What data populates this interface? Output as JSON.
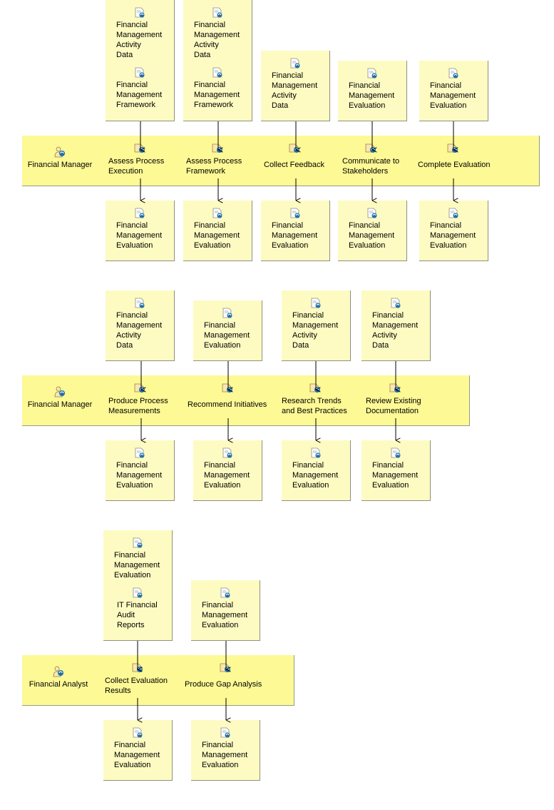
{
  "diagram": {
    "sections": [
      {
        "role": "Financial Manager",
        "tasks": [
          {
            "name": "Assess Process\nExecution",
            "inputs": [
              "Financial\nManagement\nActivity\nData",
              "Financial\nManagement\nFramework"
            ],
            "outputs": [
              "Financial\nManagement\nEvaluation"
            ]
          },
          {
            "name": "Assess Process\nFramework",
            "inputs": [
              "Financial\nManagement\nActivity\nData",
              "Financial\nManagement\nFramework"
            ],
            "outputs": [
              "Financial\nManagement\nEvaluation"
            ]
          },
          {
            "name": "Collect Feedback",
            "inputs": [
              "Financial\nManagement\nActivity\nData"
            ],
            "outputs": [
              "Financial\nManagement\nEvaluation"
            ]
          },
          {
            "name": "Communicate to\nStakeholders",
            "inputs": [
              "Financial\nManagement\nEvaluation"
            ],
            "outputs": [
              "Financial\nManagement\nEvaluation"
            ]
          },
          {
            "name": "Complete Evaluation",
            "inputs": [
              "Financial\nManagement\nEvaluation"
            ],
            "outputs": [
              "Financial\nManagement\nEvaluation"
            ]
          }
        ]
      },
      {
        "role": "Financial Manager",
        "tasks": [
          {
            "name": "Produce Process\nMeasurements",
            "inputs": [
              "Financial\nManagement\nActivity\nData"
            ],
            "outputs": [
              "Financial\nManagement\nEvaluation"
            ]
          },
          {
            "name": "Recommend Initiatives",
            "inputs": [
              "Financial\nManagement\nEvaluation"
            ],
            "outputs": [
              "Financial\nManagement\nEvaluation"
            ]
          },
          {
            "name": "Research Trends\nand Best Practices",
            "inputs": [
              "Financial\nManagement\nActivity\nData"
            ],
            "outputs": [
              "Financial\nManagement\nEvaluation"
            ]
          },
          {
            "name": "Review Existing\nDocumentation",
            "inputs": [
              "Financial\nManagement\nActivity\nData"
            ],
            "outputs": [
              "Financial\nManagement\nEvaluation"
            ]
          }
        ]
      },
      {
        "role": "Financial Analyst",
        "tasks": [
          {
            "name": "Collect Evaluation\nResults",
            "inputs": [
              "Financial\nManagement\nEvaluation",
              "IT Financial\nAudit\nReports"
            ],
            "outputs": [
              "Financial\nManagement\nEvaluation"
            ]
          },
          {
            "name": "Produce Gap Analysis",
            "inputs": [
              "Financial\nManagement\nEvaluation"
            ],
            "outputs": [
              "Financial\nManagement\nEvaluation"
            ]
          }
        ]
      }
    ]
  },
  "icons": {
    "role": "role-icon",
    "task": "task-icon",
    "artifact": "artifact-icon"
  },
  "colors": {
    "lane_fill": "#fdf995",
    "artifact_fill": "#fdfbc1",
    "edge": "#000000",
    "icon_blue": "#1f6fa8"
  }
}
